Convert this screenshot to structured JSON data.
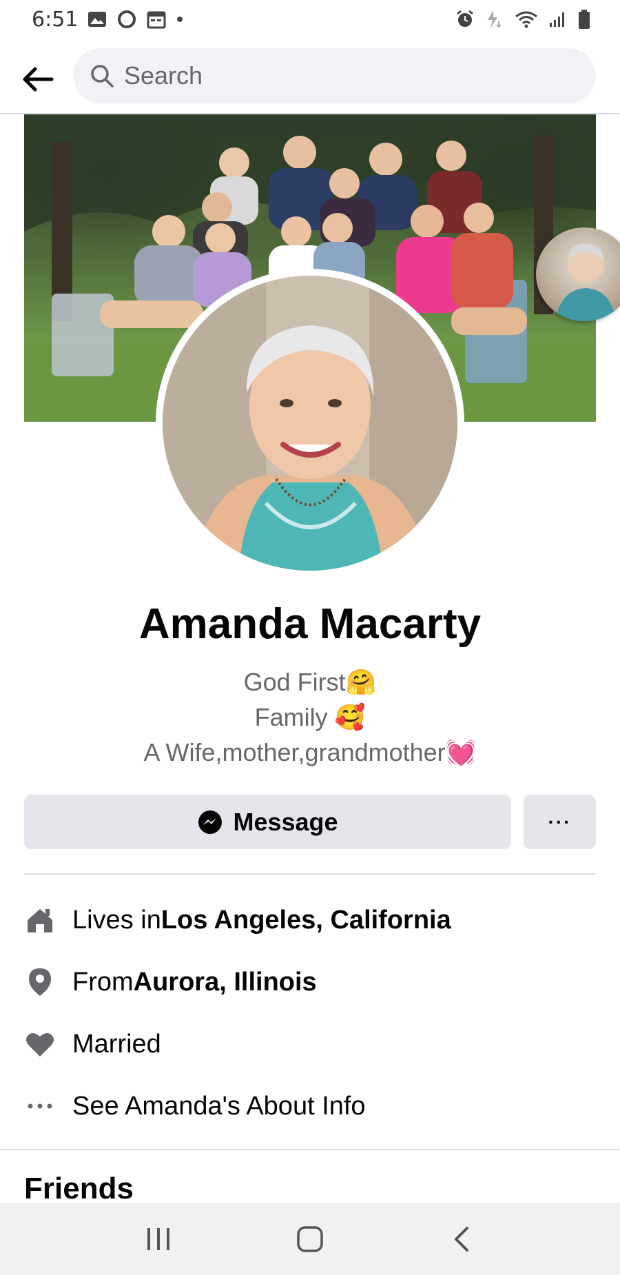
{
  "status_bar": {
    "time": "6:51",
    "left_icons": [
      "image-icon",
      "circle-icon",
      "calendar-icon",
      "dot-icon"
    ],
    "right_icons": [
      "alarm-icon",
      "charging-icon",
      "wifi-icon",
      "signal-icon",
      "battery-icon"
    ]
  },
  "topbar": {
    "back_icon": "arrow-left-icon",
    "search_placeholder": "Search"
  },
  "profile": {
    "name": "Amanda Macarty",
    "bio_lines": [
      {
        "text": "God First",
        "emoji": "🤗"
      },
      {
        "text": "Family ",
        "emoji": "🥰"
      },
      {
        "text": "A Wife,mother,grandmother",
        "emoji": "💓"
      }
    ]
  },
  "actions": {
    "message_label": "Message",
    "more_label": "···"
  },
  "info": [
    {
      "icon": "home-icon",
      "prefix": "Lives in ",
      "bold": "Los Angeles, California"
    },
    {
      "icon": "location-pin-icon",
      "prefix": "From ",
      "bold": "Aurora, Illinois"
    },
    {
      "icon": "heart-icon",
      "prefix": "Married",
      "bold": ""
    },
    {
      "icon": "more-dots-icon",
      "prefix": "See Amanda's About Info",
      "bold": ""
    }
  ],
  "sections": {
    "friends_heading": "Friends"
  },
  "colors": {
    "accent_text": "#050505",
    "secondary_text": "#65676b",
    "button_bg": "#e4e6eb",
    "search_bg": "#f0f2f5"
  }
}
